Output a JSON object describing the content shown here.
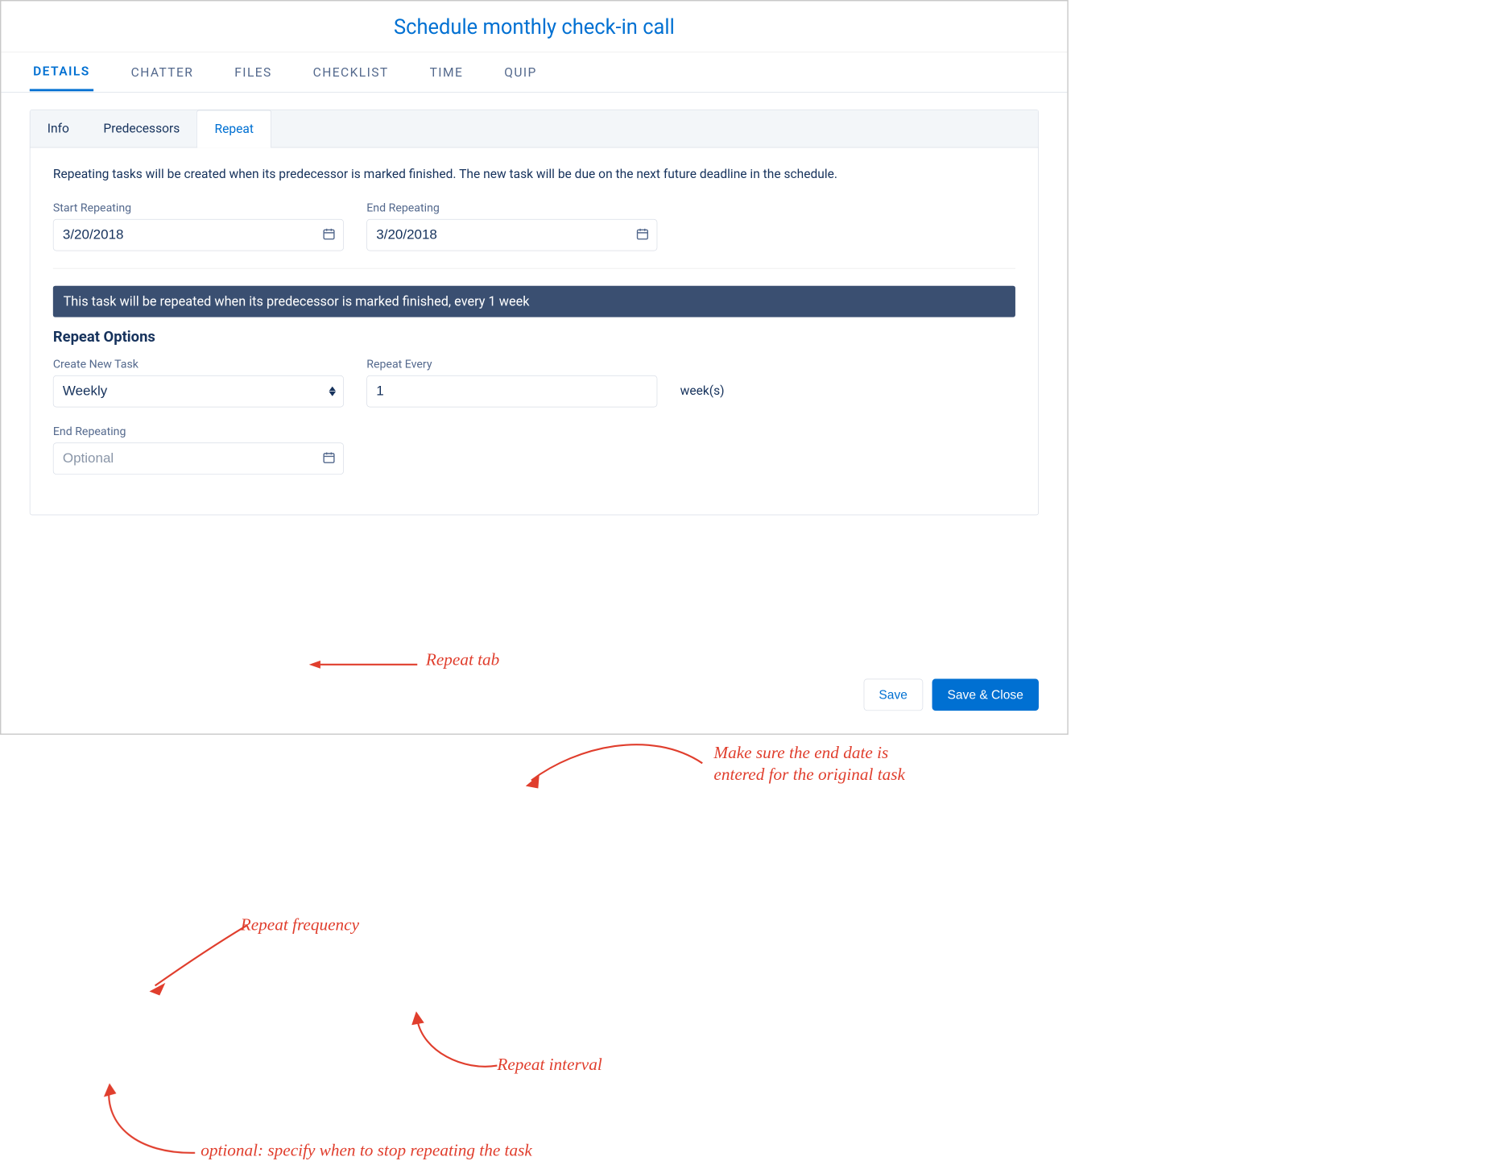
{
  "title": "Schedule monthly check-in call",
  "tabs": [
    "DETAILS",
    "CHATTER",
    "FILES",
    "CHECKLIST",
    "TIME",
    "QUIP"
  ],
  "active_tab": "DETAILS",
  "subtabs": [
    "Info",
    "Predecessors",
    "Repeat"
  ],
  "active_subtab": "Repeat",
  "description": "Repeating tasks will be created when its predecessor is marked finished. The new task will be due on the next future deadline in the schedule.",
  "start_repeating": {
    "label": "Start Repeating",
    "value": "3/20/2018"
  },
  "end_repeating_top": {
    "label": "End Repeating",
    "value": "3/20/2018"
  },
  "summary": "This task will be repeated when its predecessor is marked finished, every 1 week",
  "repeat_options_title": "Repeat Options",
  "create_new_task": {
    "label": "Create New Task",
    "value": "Weekly"
  },
  "repeat_every": {
    "label": "Repeat Every",
    "value": "1",
    "unit": "week(s)"
  },
  "end_repeating_bottom": {
    "label": "End Repeating",
    "placeholder": "Optional"
  },
  "buttons": {
    "save": "Save",
    "save_close": "Save & Close"
  },
  "annotations": {
    "repeat_tab": "Repeat tab",
    "end_date": "Make sure the end date is\nentered for the original task",
    "freq": "Repeat frequency",
    "interval": "Repeat interval",
    "optional": "optional: specify when to stop repeating the task"
  }
}
